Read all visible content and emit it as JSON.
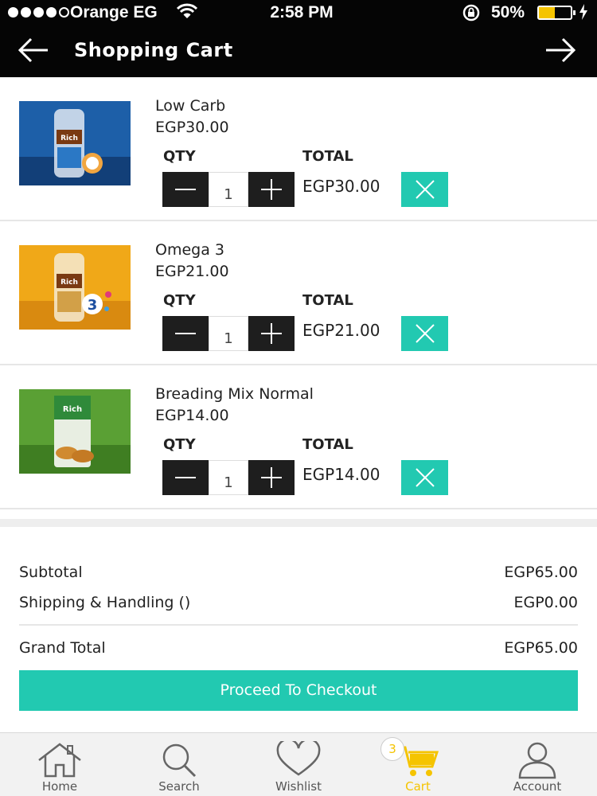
{
  "status_bar": {
    "carrier": "Orange EG",
    "time": "2:58 PM",
    "battery_percent": "50%",
    "battery_level": 0.5,
    "battery_color": "#f5c400",
    "signal_bars_filled": 4
  },
  "header": {
    "title": "Shopping Cart",
    "back_icon": "arrow-left-icon",
    "forward_icon": "arrow-right-icon"
  },
  "labels": {
    "qty": "QTY",
    "total": "TOTAL"
  },
  "items": [
    {
      "name": "Low Carb",
      "price": "EGP30.00",
      "qty": "1",
      "total": "EGP30.00"
    },
    {
      "name": "Omega 3",
      "price": "EGP21.00",
      "qty": "1",
      "total": "EGP21.00"
    },
    {
      "name": "Breading Mix Normal",
      "price": "EGP14.00",
      "qty": "1",
      "total": "EGP14.00"
    }
  ],
  "summary": {
    "subtotal_label": "Subtotal",
    "subtotal_value": "EGP65.00",
    "shipping_label": "Shipping & Handling ()",
    "shipping_value": "EGP0.00",
    "grand_total_label": "Grand Total",
    "grand_total_value": "EGP65.00"
  },
  "checkout_label": "Proceed To Checkout",
  "tabbar": {
    "tabs": [
      {
        "label": "Home",
        "icon": "home-icon"
      },
      {
        "label": "Search",
        "icon": "search-icon"
      },
      {
        "label": "Wishlist",
        "icon": "heart-icon"
      },
      {
        "label": "Cart",
        "icon": "cart-icon"
      },
      {
        "label": "Account",
        "icon": "user-icon"
      }
    ],
    "active_tab": "Cart",
    "cart_badge": "3"
  },
  "colors": {
    "accent": "#22c9b1",
    "active_tab": "#f5c400",
    "header_bg": "#050505",
    "stepper_bg": "#1e1e1e"
  }
}
